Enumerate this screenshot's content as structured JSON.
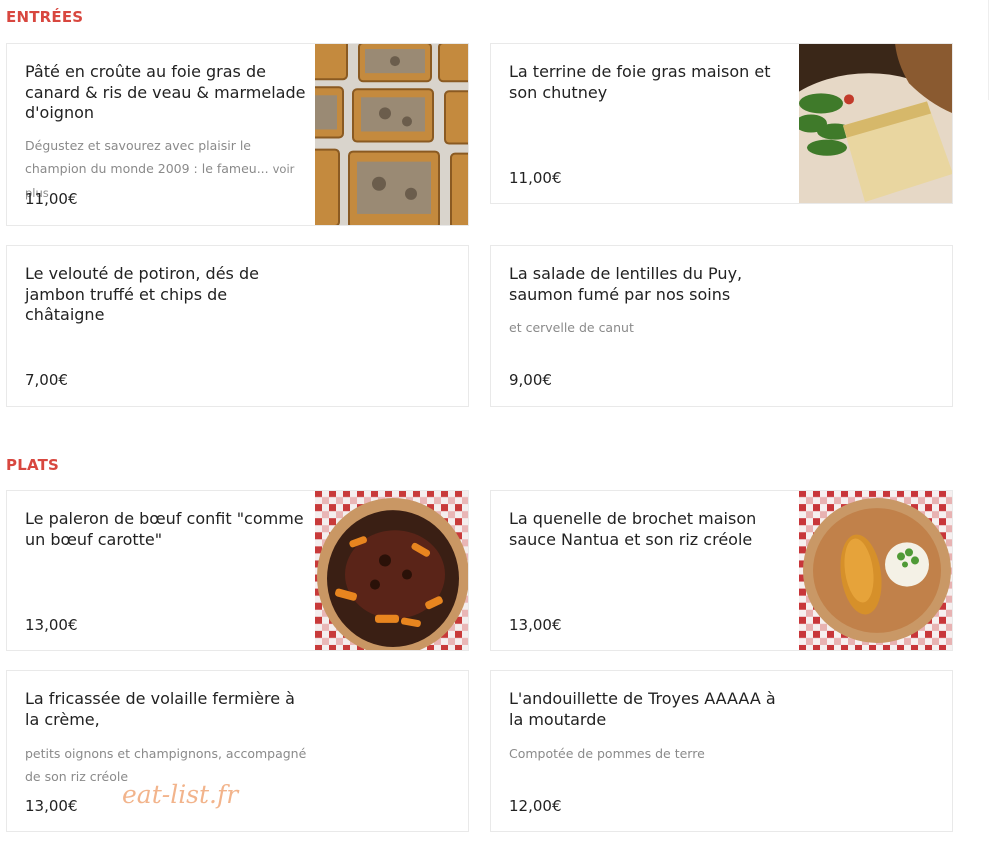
{
  "sections": {
    "entrees": {
      "title": "ENTRÉES",
      "items": [
        {
          "name": "Pâté en croûte au foie gras de canard & ris de veau & marmelade d'oignon",
          "desc": "Dégustez et savourez avec plaisir le champion du monde 2009 : le fameu...",
          "more": "voir plus",
          "price": "11,00€"
        },
        {
          "name": "La terrine de foie gras maison et son chutney",
          "price": "11,00€"
        },
        {
          "name": "Le velouté de potiron, dés de jambon truffé et chips de châtaigne",
          "price": "7,00€"
        },
        {
          "name": "La salade de lentilles du Puy, saumon fumé par nos soins",
          "desc": "et cervelle de canut",
          "price": "9,00€"
        }
      ]
    },
    "plats": {
      "title": "PLATS",
      "items": [
        {
          "name": "Le paleron de bœuf confit \"comme un bœuf carotte\"",
          "price": "13,00€"
        },
        {
          "name": "La quenelle de brochet maison sauce Nantua et son riz créole",
          "price": "13,00€"
        },
        {
          "name": "La fricassée de volaille fermière à la crème,",
          "desc": "petits oignons et champignons, accompagné de son riz créole",
          "price": "13,00€"
        },
        {
          "name": "L'andouillette de Troyes AAAAA à la moutarde",
          "desc": "Compotée de pommes de terre",
          "price": "12,00€"
        }
      ]
    }
  },
  "watermark": "eat-list.fr"
}
